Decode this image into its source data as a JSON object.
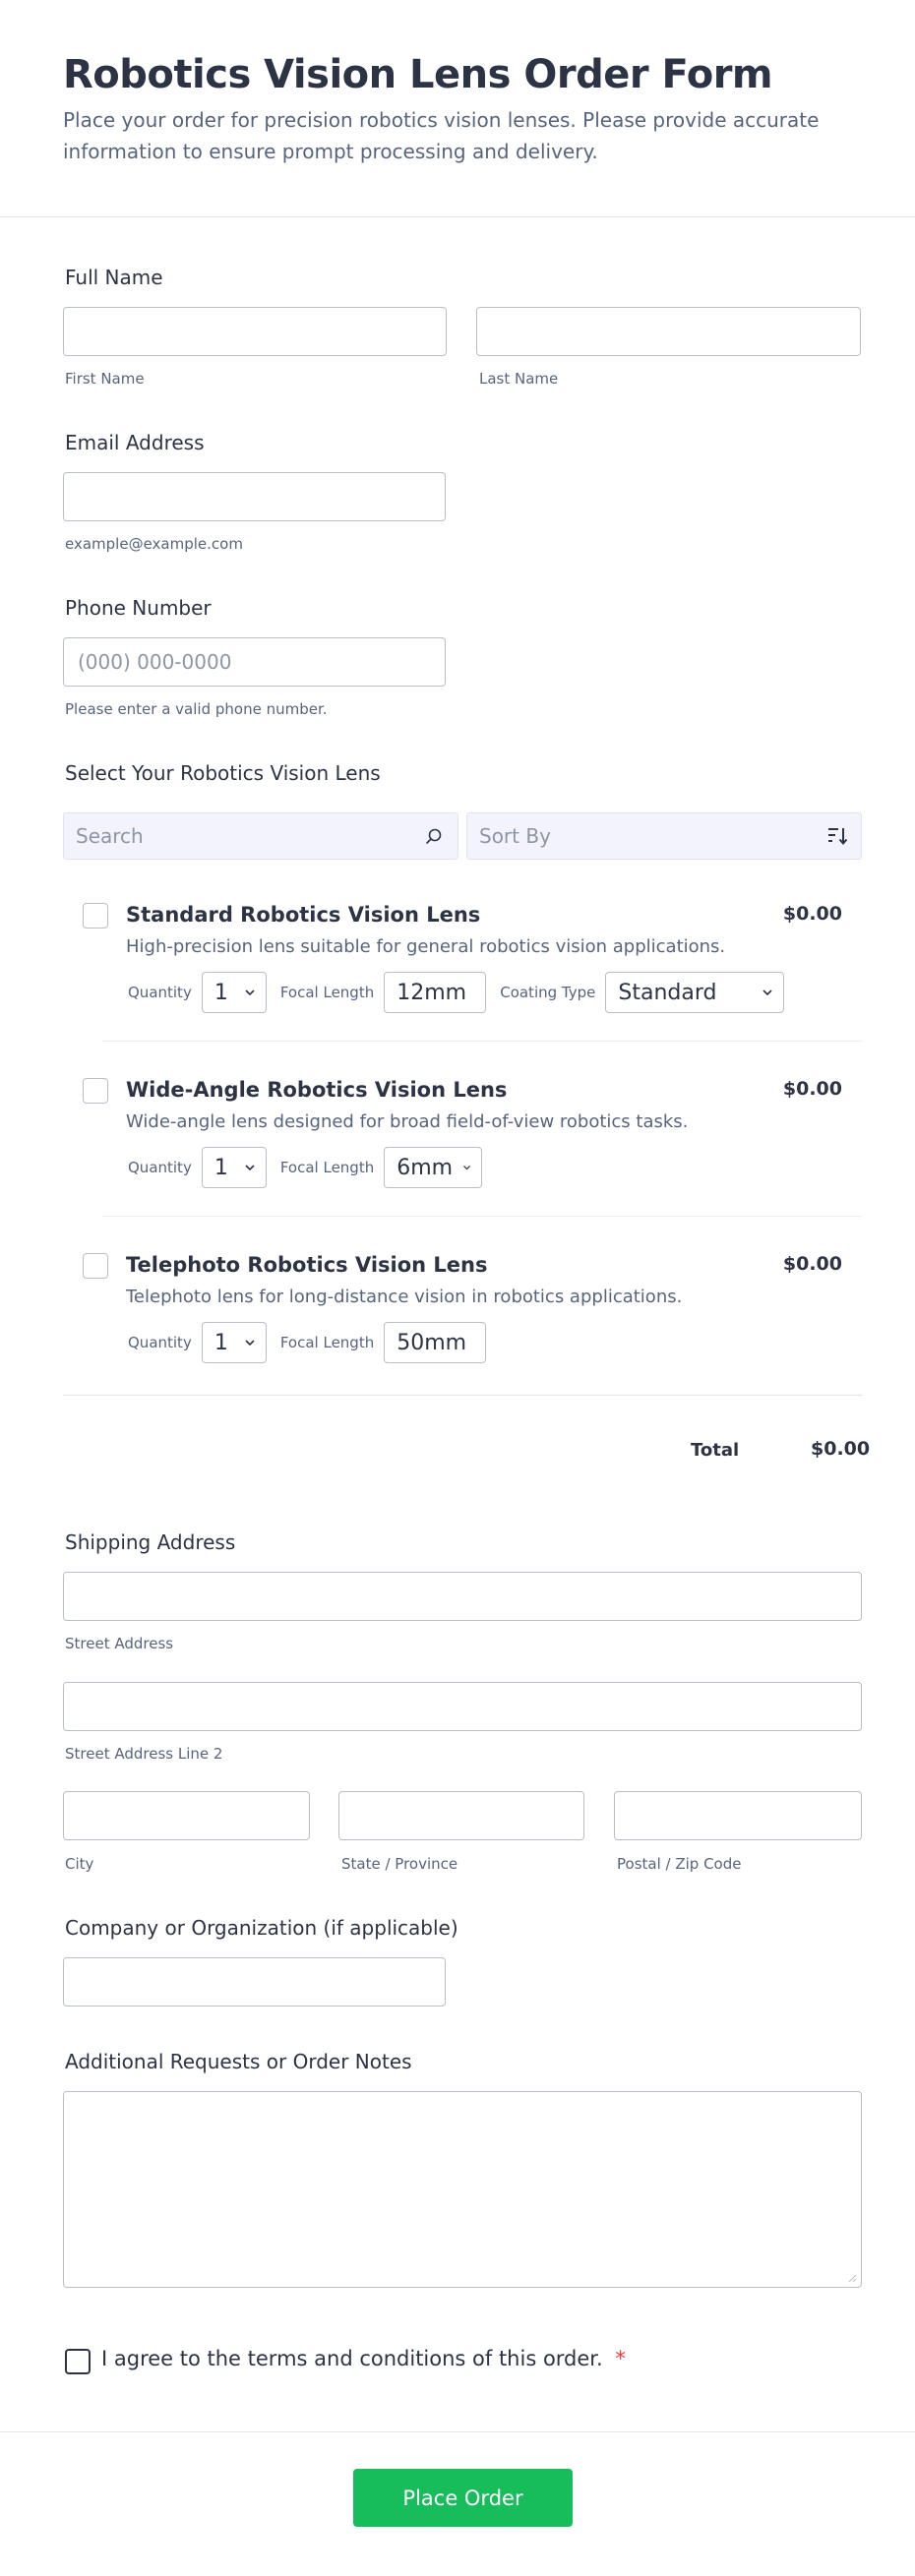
{
  "header": {
    "title": "Robotics Vision Lens Order Form",
    "subtitle": "Place your order for precision robotics vision lenses. Please provide accurate information to ensure prompt processing and delivery."
  },
  "full_name": {
    "label": "Full Name",
    "first_sublabel": "First Name",
    "last_sublabel": "Last Name"
  },
  "email": {
    "label": "Email Address",
    "sublabel": "example@example.com"
  },
  "phone": {
    "label": "Phone Number",
    "placeholder": "(000) 000-0000",
    "sublabel": "Please enter a valid phone number."
  },
  "products": {
    "label": "Select Your Robotics Vision Lens",
    "search_placeholder": "Search",
    "sort_placeholder": "Sort By",
    "items": [
      {
        "name": "Standard Robotics Vision Lens",
        "description": "High-precision lens suitable for general robotics vision applications.",
        "price": "$0.00",
        "quantity_label": "Quantity",
        "quantity": "1",
        "focal_label": "Focal Length",
        "focal": "12mm",
        "coating_label": "Coating Type",
        "coating": "Standard"
      },
      {
        "name": "Wide-Angle Robotics Vision Lens",
        "description": "Wide-angle lens designed for broad field-of-view robotics tasks.",
        "price": "$0.00",
        "quantity_label": "Quantity",
        "quantity": "1",
        "focal_label": "Focal Length",
        "focal": "6mm"
      },
      {
        "name": "Telephoto Robotics Vision Lens",
        "description": "Telephoto lens for long-distance vision in robotics applications.",
        "price": "$0.00",
        "quantity_label": "Quantity",
        "quantity": "1",
        "focal_label": "Focal Length",
        "focal": "50mm"
      }
    ],
    "total_label": "Total",
    "total_value": "$0.00"
  },
  "shipping": {
    "label": "Shipping Address",
    "street_sublabel": "Street Address",
    "street2_sublabel": "Street Address Line 2",
    "city_sublabel": "City",
    "state_sublabel": "State / Province",
    "zip_sublabel": "Postal / Zip Code"
  },
  "company": {
    "label": "Company or Organization (if applicable)"
  },
  "notes": {
    "label": "Additional Requests or Order Notes"
  },
  "agreement": {
    "text": "I agree to the terms and conditions of this order.",
    "required_mark": "*"
  },
  "submit": {
    "label": "Place Order"
  },
  "colors": {
    "accent": "#18bd5b",
    "required": "#f23a3c",
    "text": "#2c3345",
    "muted": "#57647e"
  }
}
